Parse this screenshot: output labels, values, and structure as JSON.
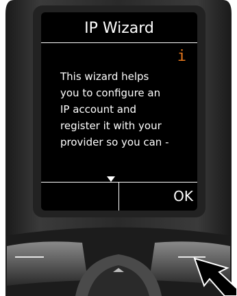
{
  "screen": {
    "title": "IP Wizard",
    "info_icon": "i",
    "body_lines": [
      "This wizard helps",
      "you to configure an",
      "IP account and",
      "register it with your",
      "provider so you can -"
    ],
    "right_softkey": "OK",
    "accent_color": "#e8781c"
  },
  "icons": {
    "scroll_indicator": "scroll-down-arrow-icon",
    "pointer": "pointer-arrow-icon"
  }
}
